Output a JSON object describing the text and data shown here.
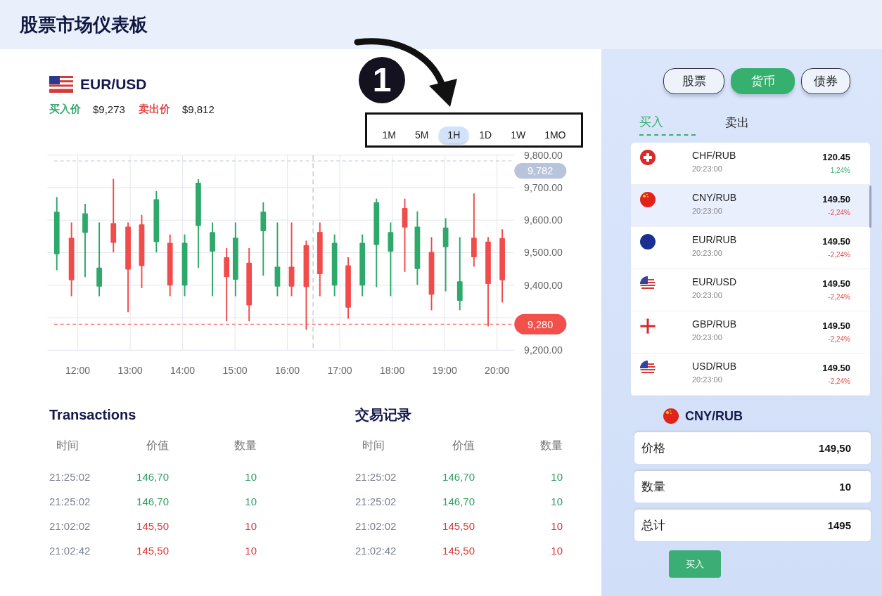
{
  "header": {
    "title": "股票市场仪表板"
  },
  "pair": {
    "name": "EUR/USD",
    "kind": "us",
    "bid_label": "买入价",
    "bid": "$9,273",
    "ask_label": "卖出价",
    "ask": "$9,812"
  },
  "annotation": {
    "number": "1"
  },
  "timeframes": [
    {
      "label": "1M",
      "selected": false
    },
    {
      "label": "5M",
      "selected": false
    },
    {
      "label": "1H",
      "selected": true
    },
    {
      "label": "1D",
      "selected": false
    },
    {
      "label": "1W",
      "selected": false
    },
    {
      "label": "1MO",
      "selected": false
    }
  ],
  "chart": {
    "chart_data": {
      "type": "candlestick",
      "grid": true,
      "ref_lines": [
        {
          "axis": "x",
          "value": 16.49,
          "color": "#c9ccd4"
        },
        {
          "axis": "y",
          "value": 9782,
          "label": "9,782",
          "color": "#b8c4dc"
        },
        {
          "axis": "y",
          "value": 9280,
          "label": "9,280",
          "color": "#f2504a"
        }
      ],
      "x": [
        11.6,
        11.88,
        12.14,
        12.41,
        12.68,
        12.96,
        13.22,
        13.5,
        13.76,
        14.04,
        14.3,
        14.57,
        14.84,
        15.01,
        15.27,
        15.54,
        15.81,
        16.08,
        16.36,
        16.62,
        16.9,
        17.16,
        17.43,
        17.7,
        17.97,
        18.24,
        18.48,
        18.75,
        19.02,
        19.29,
        19.56,
        19.83,
        20.1
      ],
      "ohlc": [
        [
          9495,
          9671,
          9446,
          9626
        ],
        [
          9546,
          9593,
          9366,
          9415
        ],
        [
          9561,
          9650,
          9425,
          9621
        ],
        [
          9396,
          9593,
          9366,
          9454
        ],
        [
          9591,
          9727,
          9501,
          9530
        ],
        [
          9580,
          9593,
          9317,
          9448
        ],
        [
          9587,
          9616,
          9391,
          9459
        ],
        [
          9533,
          9689,
          9501,
          9664
        ],
        [
          9530,
          9556,
          9366,
          9399
        ],
        [
          9399,
          9556,
          9366,
          9530
        ],
        [
          9582,
          9726,
          9453,
          9715
        ],
        [
          9503,
          9593,
          9366,
          9563
        ],
        [
          9486,
          9514,
          9289,
          9425
        ],
        [
          9417,
          9593,
          9366,
          9546
        ],
        [
          9469,
          9514,
          9289,
          9338
        ],
        [
          9566,
          9655,
          9429,
          9626
        ],
        [
          9396,
          9593,
          9366,
          9457
        ],
        [
          9457,
          9593,
          9366,
          9396
        ],
        [
          9523,
          9537,
          9263,
          9394
        ],
        [
          9564,
          9593,
          9366,
          9434
        ],
        [
          9399,
          9556,
          9366,
          9530
        ],
        [
          9461,
          9486,
          9297,
          9331
        ],
        [
          9399,
          9556,
          9366,
          9530
        ],
        [
          9524,
          9666,
          9394,
          9655
        ],
        [
          9503,
          9593,
          9366,
          9563
        ],
        [
          9637,
          9666,
          9441,
          9577
        ],
        [
          9450,
          9627,
          9401,
          9580
        ],
        [
          9502,
          9548,
          9323,
          9371
        ],
        [
          9517,
          9606,
          9381,
          9577
        ],
        [
          9352,
          9548,
          9323,
          9412
        ],
        [
          9546,
          9682,
          9457,
          9486
        ],
        [
          9534,
          9548,
          9273,
          9404
        ],
        [
          9545,
          9572,
          9347,
          9415
        ]
      ],
      "xticks": [
        {
          "value": 12,
          "label": "12:00"
        },
        {
          "value": 13,
          "label": "13:00"
        },
        {
          "value": 14,
          "label": "14:00"
        },
        {
          "value": 15,
          "label": "15:00"
        },
        {
          "value": 16,
          "label": "16:00"
        },
        {
          "value": 17,
          "label": "17:00"
        },
        {
          "value": 18,
          "label": "18:00"
        },
        {
          "value": 19,
          "label": "19:00"
        },
        {
          "value": 20,
          "label": "20:00"
        }
      ],
      "yticks": [
        {
          "value": 9800,
          "label": "9,800.00"
        },
        {
          "value": 9700,
          "label": "9,700.00"
        },
        {
          "value": 9600,
          "label": "9,600.00"
        },
        {
          "value": 9500,
          "label": "9,500.00"
        },
        {
          "value": 9400,
          "label": "9,400.00"
        },
        {
          "value": 9200,
          "label": "9,200.00"
        }
      ],
      "xlim": [
        11.42,
        20.33
      ],
      "ylim": [
        9200,
        9800
      ]
    }
  },
  "transactions": [
    {
      "title": "Transactions",
      "columns": [
        "时间",
        "价值",
        "数量"
      ],
      "rows": [
        {
          "time": "21:25:02",
          "value": "146,70",
          "qty": "10",
          "buy": true
        },
        {
          "time": "21:25:02",
          "value": "146,70",
          "qty": "10",
          "buy": true
        },
        {
          "time": "21:02:02",
          "value": "145,50",
          "qty": "10",
          "buy": false
        },
        {
          "time": "21:02:42",
          "value": "145,50",
          "qty": "10",
          "buy": false
        }
      ]
    },
    {
      "title": "交易记录",
      "columns": [
        "时间",
        "价值",
        "数量"
      ],
      "rows": [
        {
          "time": "21:25:02",
          "value": "146,70",
          "qty": "10",
          "buy": true
        },
        {
          "time": "21:25:02",
          "value": "146,70",
          "qty": "10",
          "buy": true
        },
        {
          "time": "21:02:02",
          "value": "145,50",
          "qty": "10",
          "buy": false
        },
        {
          "time": "21:02:42",
          "value": "145,50",
          "qty": "10",
          "buy": false
        }
      ]
    }
  ],
  "categories": [
    {
      "label": "股票",
      "selected": false
    },
    {
      "label": "货币",
      "selected": true
    },
    {
      "label": "债券",
      "selected": false
    }
  ],
  "side_tabs": [
    {
      "label": "买入",
      "selected": true
    },
    {
      "label": "卖出",
      "selected": false
    }
  ],
  "quotes": [
    {
      "kind": "swiss",
      "pair": "CHF/RUB",
      "time": "20:23:00",
      "price": "120.45",
      "change": "1,24%",
      "positive": true,
      "selected": false
    },
    {
      "kind": "china",
      "pair": "CNY/RUB",
      "time": "20:23:00",
      "price": "149.50",
      "change": "-2,24%",
      "positive": false,
      "selected": true
    },
    {
      "kind": "eu",
      "pair": "EUR/RUB",
      "time": "20:23:00",
      "price": "149.50",
      "change": "-2,24%",
      "positive": false,
      "selected": false
    },
    {
      "kind": "us",
      "pair": "EUR/USD",
      "time": "20:23:00",
      "price": "149.50",
      "change": "-2,24%",
      "positive": false,
      "selected": false
    },
    {
      "kind": "england",
      "pair": "GBP/RUB",
      "time": "20:23:00",
      "price": "149.50",
      "change": "-2,24%",
      "positive": false,
      "selected": false
    },
    {
      "kind": "us",
      "pair": "USD/RUB",
      "time": "20:23:00",
      "price": "149.50",
      "change": "-2,24%",
      "positive": false,
      "selected": false
    }
  ],
  "order": {
    "kind": "china",
    "pair": "CNY/RUB",
    "fields": [
      {
        "label": "价格",
        "value": "149,50"
      },
      {
        "label": "数量",
        "value": "10"
      },
      {
        "label": "总计",
        "value": "1495"
      }
    ],
    "button": "买入"
  }
}
